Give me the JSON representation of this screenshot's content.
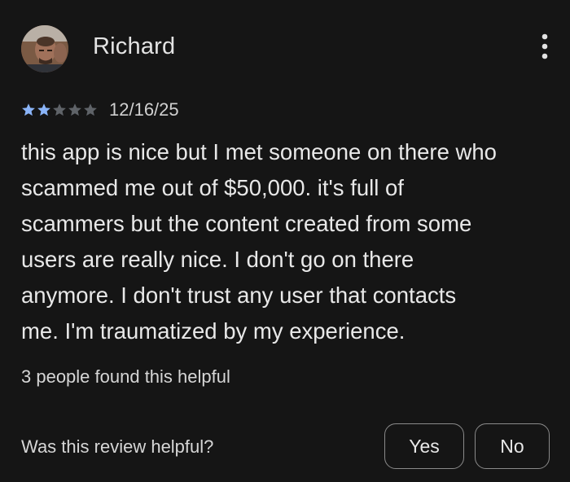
{
  "reviewer": {
    "name": "Richard",
    "avatar_icon": "profile-photo"
  },
  "rating": {
    "value": 2,
    "max": 5,
    "filled_color": "#8ab4f8",
    "empty_color": "#5f6368"
  },
  "review": {
    "date": "12/16/25",
    "text": "this app is nice but I met someone on there who\nscammed me out of $50,000. it's full of\nscammers but the content created from some\nusers are really nice. I don't go on there\nanymore. I don't trust any user that contacts\nme. I'm traumatized by my experience."
  },
  "helpful": {
    "count_text": "3 people found this helpful",
    "question": "Was this review helpful?",
    "yes_label": "Yes",
    "no_label": "No"
  },
  "menu": {
    "icon": "more-vert-icon"
  },
  "theme": {
    "background": "#151515",
    "text": "#e8e8e8",
    "button_border": "#8a8a8a"
  }
}
